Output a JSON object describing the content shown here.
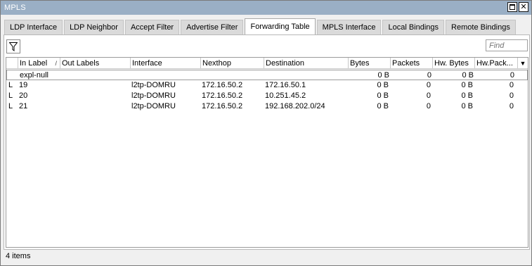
{
  "window": {
    "title": "MPLS"
  },
  "tabs": [
    {
      "label": "LDP Interface"
    },
    {
      "label": "LDP Neighbor"
    },
    {
      "label": "Accept Filter"
    },
    {
      "label": "Advertise Filter"
    },
    {
      "label": "Forwarding Table",
      "active": true
    },
    {
      "label": "MPLS Interface"
    },
    {
      "label": "Local Bindings"
    },
    {
      "label": "Remote Bindings"
    }
  ],
  "toolbar": {
    "find_placeholder": "Find",
    "filter_icon": "filter-icon"
  },
  "table": {
    "columns": [
      "In Label",
      "Out Labels",
      "Interface",
      "Nexthop",
      "Destination",
      "Bytes",
      "Packets",
      "Hw. Bytes",
      "Hw.Pack..."
    ],
    "sort_indicator": "/",
    "rows": [
      {
        "flag": "",
        "in_label": "expl-null",
        "out_labels": "",
        "interface": "",
        "nexthop": "",
        "destination": "",
        "bytes": "0 B",
        "packets": "0",
        "hw_bytes": "0 B",
        "hw_packets": "0"
      },
      {
        "flag": "L",
        "in_label": "19",
        "out_labels": "",
        "interface": "l2tp-DOMRU",
        "nexthop": "172.16.50.2",
        "destination": "172.16.50.1",
        "bytes": "0 B",
        "packets": "0",
        "hw_bytes": "0 B",
        "hw_packets": "0"
      },
      {
        "flag": "L",
        "in_label": "20",
        "out_labels": "",
        "interface": "l2tp-DOMRU",
        "nexthop": "172.16.50.2",
        "destination": "10.251.45.2",
        "bytes": "0 B",
        "packets": "0",
        "hw_bytes": "0 B",
        "hw_packets": "0"
      },
      {
        "flag": "L",
        "in_label": "21",
        "out_labels": "",
        "interface": "l2tp-DOMRU",
        "nexthop": "172.16.50.2",
        "destination": "192.168.202.0/24",
        "bytes": "0 B",
        "packets": "0",
        "hw_bytes": "0 B",
        "hw_packets": "0"
      }
    ]
  },
  "status": {
    "items_text": "4 items"
  },
  "colors": {
    "titlebar": "#9aafc5",
    "tab_inactive": "#dadada",
    "tab_active": "#ffffff"
  }
}
